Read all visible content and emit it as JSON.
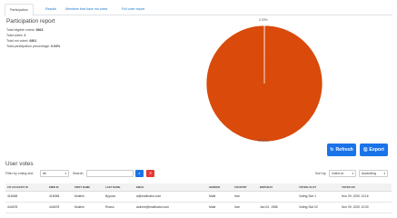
{
  "tabs": [
    {
      "label": "Participation",
      "active": true
    },
    {
      "label": "Results",
      "active": false
    },
    {
      "label": "Members that have not votes",
      "active": false
    },
    {
      "label": "Full voter report",
      "active": false
    }
  ],
  "report": {
    "title": "Participation report",
    "eligible_label": "Total eligible voters:",
    "eligible_value": "6863",
    "voted_label": "Total voted:",
    "voted_value": "2",
    "not_voted_label": "Total not voted:",
    "not_voted_value": "6861",
    "percentage_label": "Total participation percentage:",
    "percentage_value": "0.03%"
  },
  "chart_data": {
    "type": "pie",
    "slices": [
      {
        "value": 0.03,
        "label": "0.03%",
        "color": "#ffffff"
      },
      {
        "value": 99.97,
        "label": "99.97%",
        "color": "#d94a0b"
      }
    ]
  },
  "buttons": {
    "refresh": "Refresh",
    "export": "Export"
  },
  "votes": {
    "title": "User votes",
    "filter_label": "Filter by voting slot:",
    "filter_value": "All",
    "search_label": "Search:",
    "search_value": "",
    "sort_label": "Sort by:",
    "sort_value": "Voted on",
    "order_value": "Ascending"
  },
  "table": {
    "headers": [
      "CIT ACCOUNT ID",
      "EMID ID",
      "FIRST NAME",
      "LAST NAME",
      "EMAIL",
      "GENDER",
      "COUNTRY",
      "BIRTHDAY",
      "VOTING SLOT",
      "VOTED ON"
    ],
    "rows": [
      [
        "416068",
        "416068",
        "Mukhin",
        "Bypuco",
        "a@mailinator.com",
        "Male",
        "Iran",
        "",
        "Voting Slot 1",
        "Nov 09, 2020 13:16"
      ],
      [
        "444678",
        "444678",
        "Mukhin",
        "Rosso",
        "activee@mailinator.com",
        "Male",
        "Iran",
        "Jan 04, 1986",
        "Voting Slot 02",
        "Nov 09, 2020 13:30"
      ]
    ]
  },
  "colors": {
    "accent": "#1a73e8",
    "pie_main": "#d94a0b",
    "search_button": "#1a73e8",
    "clear_button": "#e53935"
  },
  "icons": {
    "refresh": "refresh-icon",
    "export": "save-icon",
    "search": "search-icon",
    "clear": "close-icon"
  }
}
